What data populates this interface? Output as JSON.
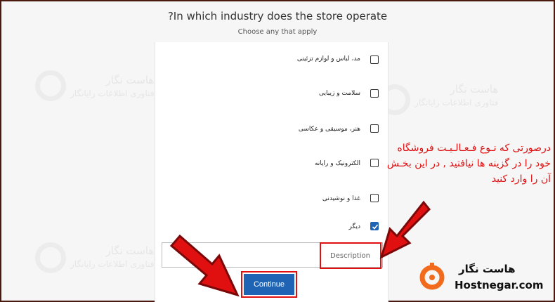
{
  "header": {
    "title": "?In which industry does the store operate",
    "subtitle": "Choose any that apply"
  },
  "options": [
    {
      "label": "مد، لباس و لوازم تزئینی",
      "checked": false
    },
    {
      "label": "سلامت و زیبایی",
      "checked": false
    },
    {
      "label": "هنر، موسیقی و عکاسی",
      "checked": false
    },
    {
      "label": "الکترونیک و رایانه",
      "checked": false
    },
    {
      "label": "غذا و نوشیدنی",
      "checked": false
    },
    {
      "label": "دیگر",
      "checked": true
    }
  ],
  "description": {
    "placeholder": "Description"
  },
  "continue_label": "Continue",
  "annotation": {
    "text": "درصورتی که نـوع فـعـالـیـت فروشگاه خود را در گزینه ها نیافتید , در این بخـش آن را وارد کنید"
  },
  "watermark": {
    "title": "هاست نگار",
    "subtitle": "فناوری اطلاعات رایانگار"
  },
  "brand": {
    "name_fa": "هاست نگار",
    "name_en": "Hostnegar.com"
  },
  "colors": {
    "accent": "#1e63b4",
    "highlight": "#e01010",
    "brand_orange": "#f26a1b"
  }
}
